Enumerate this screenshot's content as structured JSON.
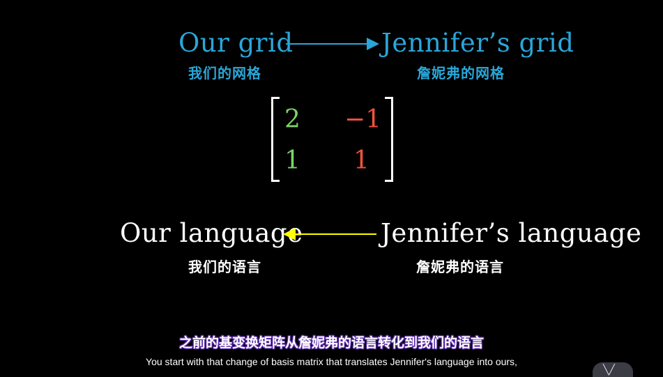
{
  "scene": {
    "top": {
      "left_title": "Our grid",
      "left_subtitle": "我们的网格",
      "right_title": "Jennifer’s grid",
      "right_subtitle": "詹妮弗的网格",
      "arrow_direction": "right",
      "arrow_color": "#2aa6d8"
    },
    "matrix": {
      "row1": [
        "2",
        "−1"
      ],
      "row2": [
        "1",
        "1"
      ],
      "column_colors": [
        "#7ed36a",
        "#f0533e"
      ]
    },
    "bottom": {
      "left_title": "Our language",
      "left_subtitle": "我们的语言",
      "right_title": "Jennifer’s language",
      "right_subtitle": "詹妮弗的语言",
      "arrow_direction": "left",
      "arrow_color": "#ffff00"
    }
  },
  "subtitles": {
    "chinese": "之前的基变换矩阵从詹妮弗的语言转化到我们的语言",
    "english": "You start with that change of basis matrix that translates Jennifer's language into ours,"
  },
  "overlay": {
    "icon": "tv-icon"
  }
}
